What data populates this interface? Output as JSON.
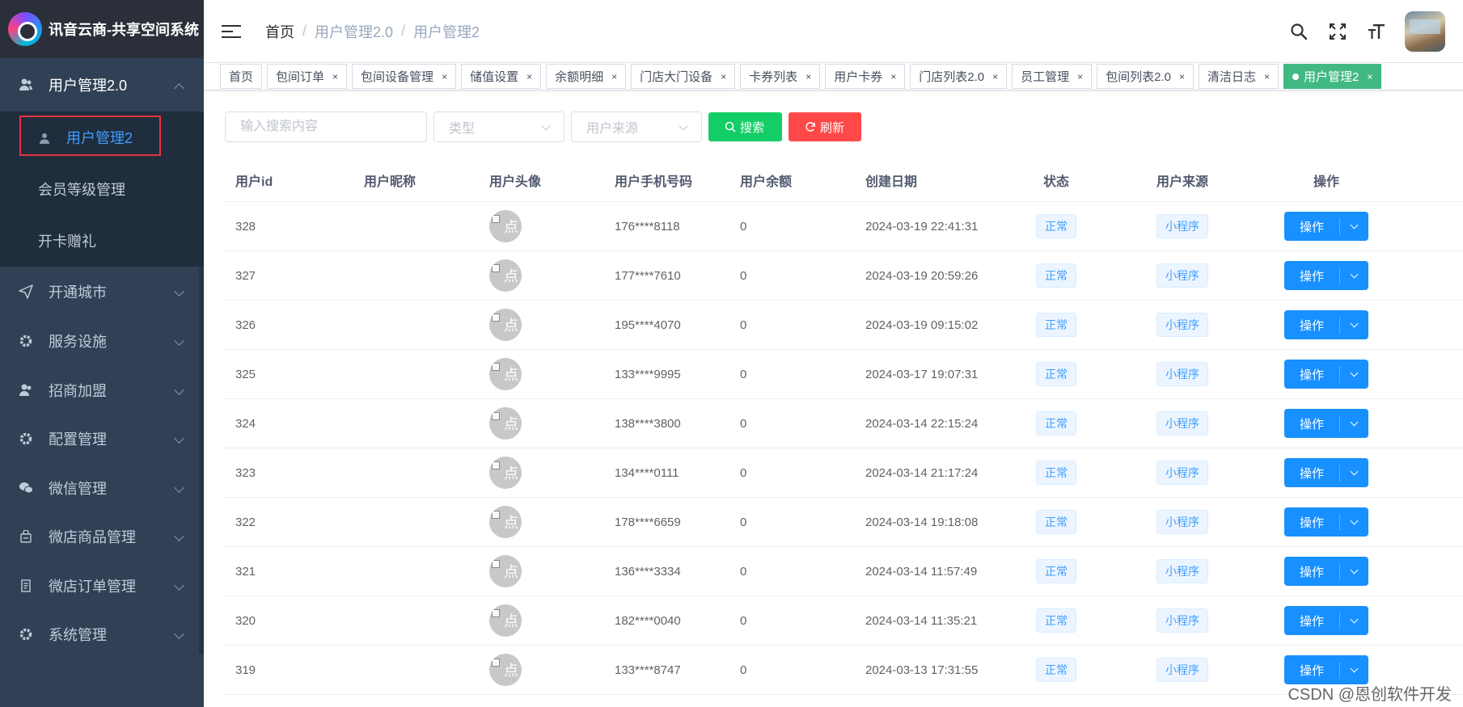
{
  "app": {
    "title": "讯音云商-共享空间系统"
  },
  "sidebar": {
    "open_group": {
      "label": "用户管理2.0",
      "icon": "user-group-icon"
    },
    "submenu": [
      {
        "label": "用户管理2",
        "active": true
      },
      {
        "label": "会员等级管理"
      },
      {
        "label": "开卡赠礼"
      }
    ],
    "groups": [
      {
        "label": "开通城市",
        "icon": "send-icon"
      },
      {
        "label": "服务设施",
        "icon": "gear-icon"
      },
      {
        "label": "招商加盟",
        "icon": "user-group-icon"
      },
      {
        "label": "配置管理",
        "icon": "gear-icon"
      },
      {
        "label": "微信管理",
        "icon": "wechat-icon"
      },
      {
        "label": "微店商品管理",
        "icon": "bag-icon"
      },
      {
        "label": "微店订单管理",
        "icon": "order-icon"
      },
      {
        "label": "系统管理",
        "icon": "gear-icon"
      }
    ]
  },
  "breadcrumb": {
    "home": "首页",
    "sep": "/",
    "level1": "用户管理2.0",
    "level2": "用户管理2"
  },
  "tags": [
    {
      "label": "首页",
      "closable": false
    },
    {
      "label": "包间订单",
      "closable": true
    },
    {
      "label": "包间设备管理",
      "closable": true
    },
    {
      "label": "储值设置",
      "closable": true
    },
    {
      "label": "余额明细",
      "closable": true
    },
    {
      "label": "门店大门设备",
      "closable": true
    },
    {
      "label": "卡券列表",
      "closable": true
    },
    {
      "label": "用户卡券",
      "closable": true
    },
    {
      "label": "门店列表2.0",
      "closable": true
    },
    {
      "label": "员工管理",
      "closable": true
    },
    {
      "label": "包间列表2.0",
      "closable": true
    },
    {
      "label": "清洁日志",
      "closable": true
    },
    {
      "label": "用户管理2",
      "closable": true,
      "active": true
    }
  ],
  "tag_close": "×",
  "filters": {
    "search_placeholder": "输入搜索内容",
    "type_placeholder": "类型",
    "source_placeholder": "用户来源",
    "search_button": "搜索",
    "refresh_button": "刷新"
  },
  "table": {
    "headers": [
      "用户id",
      "用户昵称",
      "用户头像",
      "用户手机号码",
      "用户余额",
      "创建日期",
      "状态",
      "用户来源",
      "操作"
    ],
    "avatar_alt": "点",
    "op_label": "操作",
    "rows": [
      {
        "id": "328",
        "nickname": "",
        "phone": "176****8118",
        "balance": "0",
        "created": "2024-03-19 22:41:31",
        "status": "正常",
        "source": "小程序"
      },
      {
        "id": "327",
        "nickname": "",
        "phone": "177****7610",
        "balance": "0",
        "created": "2024-03-19 20:59:26",
        "status": "正常",
        "source": "小程序"
      },
      {
        "id": "326",
        "nickname": "",
        "phone": "195****4070",
        "balance": "0",
        "created": "2024-03-19 09:15:02",
        "status": "正常",
        "source": "小程序"
      },
      {
        "id": "325",
        "nickname": "",
        "phone": "133****9995",
        "balance": "0",
        "created": "2024-03-17 19:07:31",
        "status": "正常",
        "source": "小程序"
      },
      {
        "id": "324",
        "nickname": "",
        "phone": "138****3800",
        "balance": "0",
        "created": "2024-03-14 22:15:24",
        "status": "正常",
        "source": "小程序"
      },
      {
        "id": "323",
        "nickname": "",
        "phone": "134****0111",
        "balance": "0",
        "created": "2024-03-14 21:17:24",
        "status": "正常",
        "source": "小程序"
      },
      {
        "id": "322",
        "nickname": "",
        "phone": "178****6659",
        "balance": "0",
        "created": "2024-03-14 19:18:08",
        "status": "正常",
        "source": "小程序"
      },
      {
        "id": "321",
        "nickname": "",
        "phone": "136****3334",
        "balance": "0",
        "created": "2024-03-14 11:57:49",
        "status": "正常",
        "source": "小程序"
      },
      {
        "id": "320",
        "nickname": "",
        "phone": "182****0040",
        "balance": "0",
        "created": "2024-03-14 11:35:21",
        "status": "正常",
        "source": "小程序"
      },
      {
        "id": "319",
        "nickname": "",
        "phone": "133****8747",
        "balance": "0",
        "created": "2024-03-13 17:31:55",
        "status": "正常",
        "source": "小程序"
      }
    ]
  },
  "watermark": "CSDN @恩创软件开发",
  "colors": {
    "sidebar": "#304156",
    "active_tag": "#42b983",
    "primary": "#1890ff",
    "search": "#13ce66",
    "refresh": "#ff4949"
  }
}
